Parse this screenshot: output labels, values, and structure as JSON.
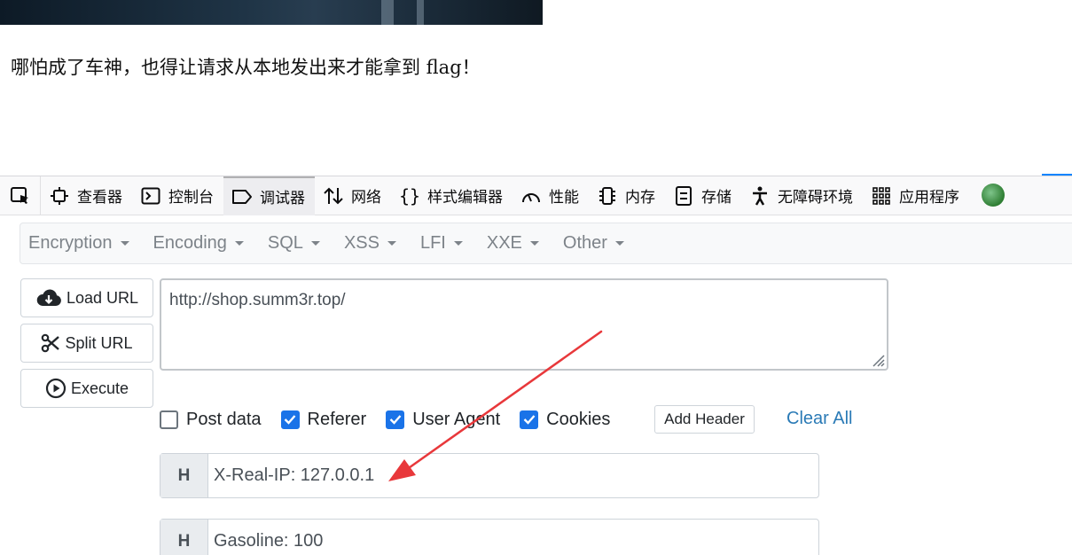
{
  "page": {
    "message": "哪怕成了车神，也得让请求从本地发出来才能拿到 flag！"
  },
  "devtools": {
    "tabs": [
      {
        "label": "查看器",
        "icon": "inspector-icon"
      },
      {
        "label": "控制台",
        "icon": "console-icon"
      },
      {
        "label": "调试器",
        "icon": "debugger-icon",
        "active": true
      },
      {
        "label": "网络",
        "icon": "network-icon"
      },
      {
        "label": "样式编辑器",
        "icon": "style-editor-icon"
      },
      {
        "label": "性能",
        "icon": "performance-icon"
      },
      {
        "label": "内存",
        "icon": "memory-icon"
      },
      {
        "label": "存储",
        "icon": "storage-icon"
      },
      {
        "label": "无障碍环境",
        "icon": "accessibility-icon"
      },
      {
        "label": "应用程序",
        "icon": "application-icon"
      }
    ]
  },
  "hackbar": {
    "menu": [
      "Encryption",
      "Encoding",
      "SQL",
      "XSS",
      "LFI",
      "XXE",
      "Other"
    ],
    "buttons": {
      "load_url": "Load URL",
      "split_url": "Split URL",
      "execute": "Execute"
    },
    "url": "http://shop.summ3r.top/",
    "options": {
      "post_data": {
        "label": "Post data",
        "checked": false
      },
      "referer": {
        "label": "Referer",
        "checked": true
      },
      "user_agent": {
        "label": "User Agent",
        "checked": true
      },
      "cookies": {
        "label": "Cookies",
        "checked": true
      }
    },
    "add_header": "Add Header",
    "clear_all": "Clear All",
    "headers": [
      {
        "tag": "H",
        "value": "X-Real-IP: 127.0.0.1"
      },
      {
        "tag": "H",
        "value": "Gasoline: 100"
      }
    ]
  },
  "colors": {
    "checkbox_checked": "#1a73e8",
    "link": "#2a7ab6",
    "annotation_arrow": "#e8383b"
  }
}
